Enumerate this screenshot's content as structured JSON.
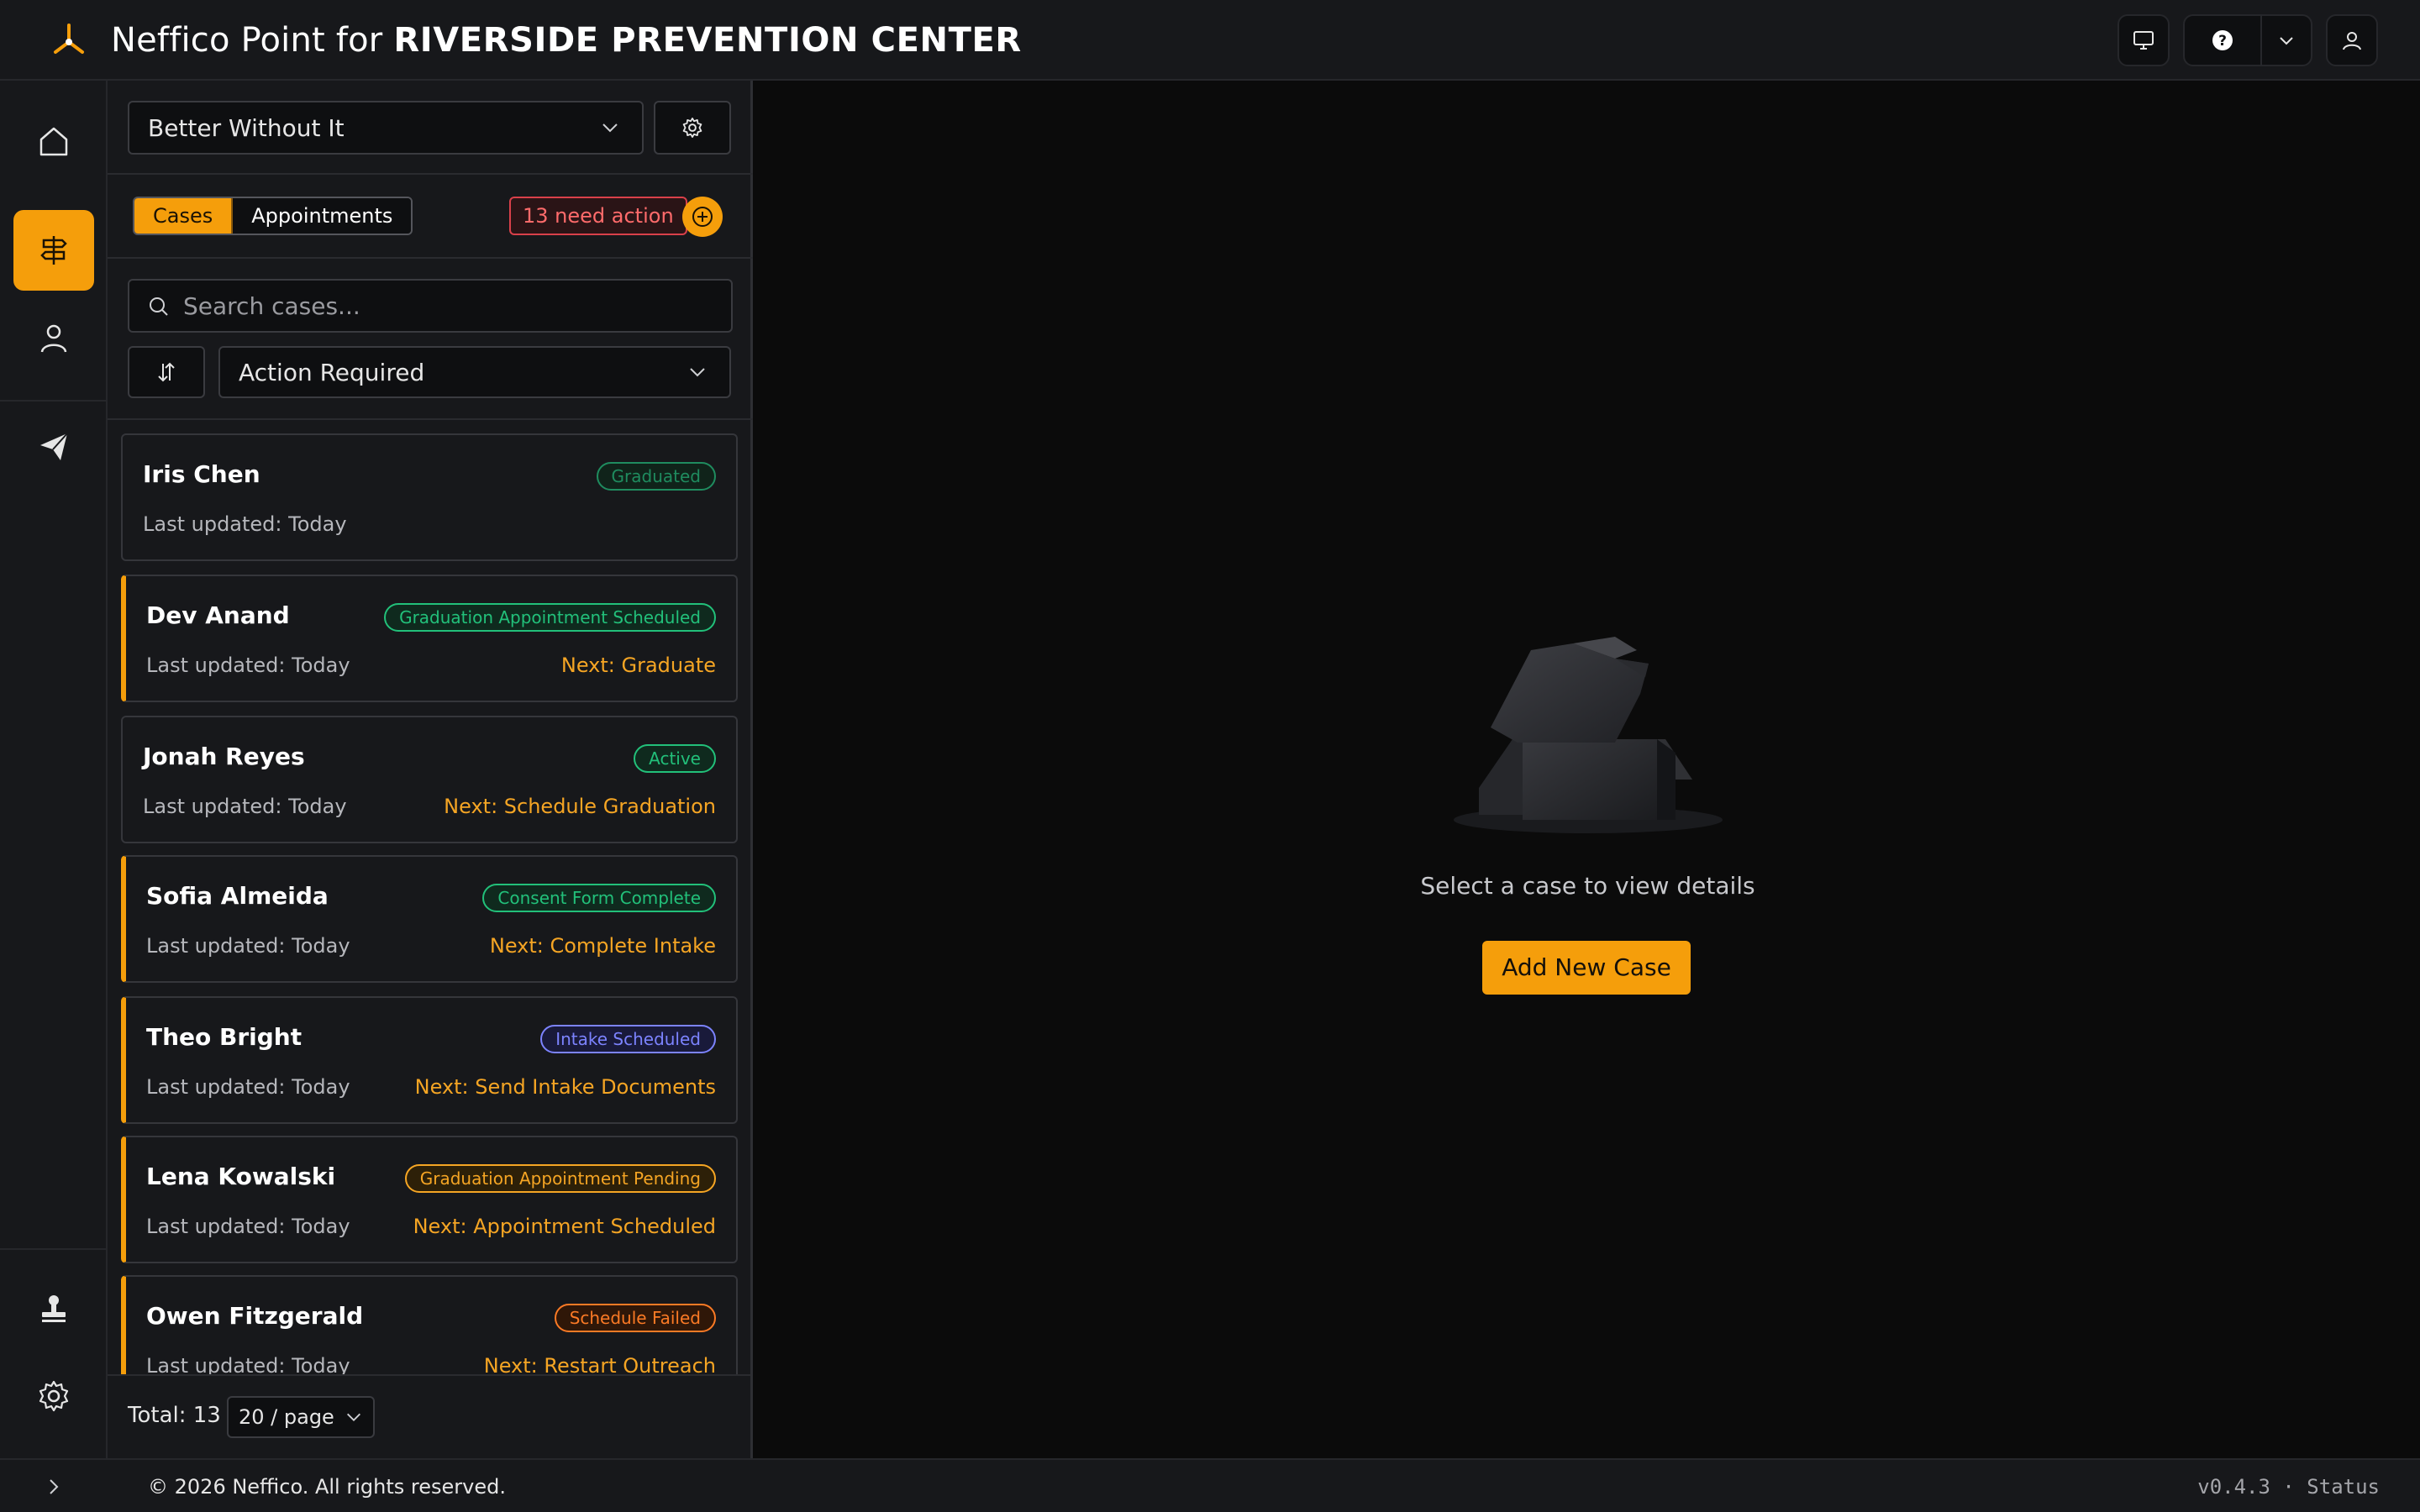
{
  "header": {
    "title_prefix": "Neffico Point for ",
    "org_name": "RIVERSIDE PREVENTION CENTER",
    "icons": [
      "monitor-icon",
      "help-icon",
      "chevron-down-icon",
      "user-icon"
    ]
  },
  "rail": {
    "items": [
      {
        "name": "home",
        "icon": "home-icon",
        "active": false
      },
      {
        "name": "cases",
        "icon": "signpost-icon",
        "active": true
      },
      {
        "name": "people",
        "icon": "user-icon",
        "active": false
      },
      {
        "name": "outreach",
        "icon": "send-icon",
        "active": false
      },
      {
        "name": "stamp",
        "icon": "stamp-icon",
        "active": false
      },
      {
        "name": "settings",
        "icon": "gear-icon",
        "active": false
      }
    ]
  },
  "panel": {
    "program_select": "Better Without It",
    "tabs": [
      {
        "label": "Cases",
        "active": true
      },
      {
        "label": "Appointments",
        "active": false
      }
    ],
    "need_action": "13 need action",
    "search_placeholder": "Search cases...",
    "filter_select": "Action Required",
    "cases": [
      {
        "name": "Iris Chen",
        "status": "Graduated",
        "status_color": "#1f8c5f",
        "updated": "Last updated: Today",
        "next": "",
        "accent": false
      },
      {
        "name": "Dev Anand",
        "status": "Graduation Appointment Scheduled",
        "status_color": "#22c07a",
        "updated": "Last updated: Today",
        "next": "Next: Graduate",
        "accent": true
      },
      {
        "name": "Jonah Reyes",
        "status": "Active",
        "status_color": "#22c07a",
        "updated": "Last updated: Today",
        "next": "Next: Schedule Graduation",
        "accent": false
      },
      {
        "name": "Sofia Almeida",
        "status": "Consent Form Complete",
        "status_color": "#22c07a",
        "updated": "Last updated: Today",
        "next": "Next: Complete Intake",
        "accent": true
      },
      {
        "name": "Theo Bright",
        "status": "Intake Scheduled",
        "status_color": "#7c83ff",
        "updated": "Last updated: Today",
        "next": "Next: Send Intake Documents",
        "accent": true
      },
      {
        "name": "Lena Kowalski",
        "status": "Graduation Appointment Pending",
        "status_color": "#f5a524",
        "updated": "Last updated: Today",
        "next": "Next: Appointment Scheduled",
        "accent": true
      },
      {
        "name": "Owen Fitzgerald",
        "status": "Schedule Failed",
        "status_color": "#fb7a25",
        "updated": "Last updated: Today",
        "next": "Next: Restart Outreach",
        "accent": true
      }
    ],
    "total": "Total: 13",
    "page_size": "20 / page"
  },
  "main": {
    "empty_text": "Select a case to view details",
    "add_case_label": "Add New Case"
  },
  "footer": {
    "copyright": "© 2026 Neffico. All rights reserved.",
    "version": "v0.4.3 · Status"
  },
  "colors": {
    "accent": "#f59e0b",
    "background": "#0b0b0b",
    "panel": "#17181b"
  }
}
